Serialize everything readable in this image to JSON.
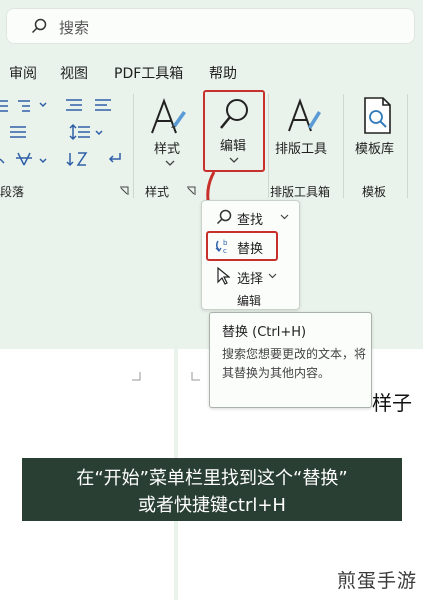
{
  "search": {
    "placeholder": "搜索"
  },
  "menu": [
    "审阅",
    "视图",
    "PDF工具箱",
    "帮助"
  ],
  "ribbon": {
    "groups": {
      "paragraph": "段落",
      "styles": "样式",
      "layout_tools": "排版工具箱",
      "template": "模板"
    },
    "buttons": {
      "styles": "样式",
      "edit": "编辑",
      "layout": "排版工具",
      "template_lib": "模板库"
    }
  },
  "dropdown": {
    "find": "查找",
    "replace": "替换",
    "select": "选择",
    "footer": "编辑"
  },
  "tooltip": {
    "title": "替换 (Ctrl+H)",
    "description": "搜索您想要更改的文本，将其替换为其他内容。"
  },
  "doc_fragment": "样子",
  "caption": {
    "line1": "在“开始”菜单栏里找到这个“替换”",
    "line2": "或者快捷键ctrl+H"
  },
  "watermark": "煎蛋手游",
  "colors": {
    "background": "#eaf3eb",
    "highlight_red": "#c8302b",
    "caption_bg": "#2a3f33"
  }
}
